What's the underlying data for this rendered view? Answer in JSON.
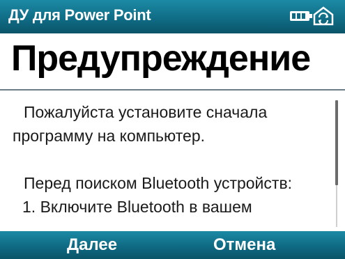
{
  "titlebar": {
    "app_title": "ДУ для Power Point",
    "icons": [
      "battery-icon",
      "sync-icon"
    ]
  },
  "header": {
    "title": "Предупреждение"
  },
  "content": {
    "lines": [
      "Пожалуйста установите сначала",
      "программу на компьютер.",
      "",
      "Перед поиском Bluetooth устройств:",
      "1. Включите Bluetooth в вашем"
    ]
  },
  "softkeys": {
    "left_label": "Далее",
    "right_label": "Отмена"
  },
  "colors": {
    "bar": "#0f6a83",
    "text": "#1a1a1a",
    "background": "#ffffff"
  }
}
